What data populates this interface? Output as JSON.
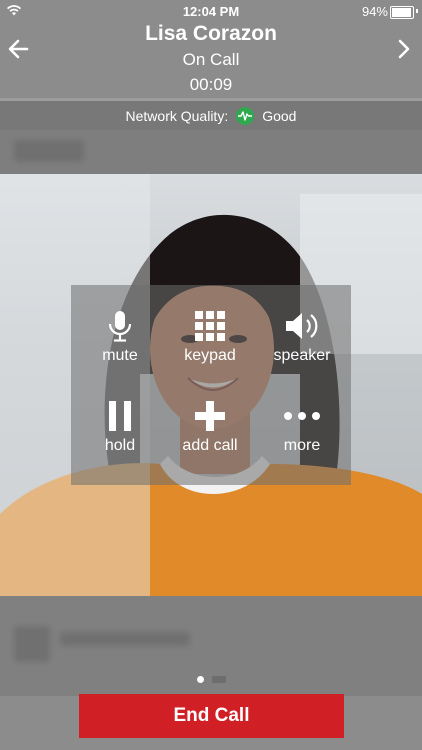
{
  "status_bar": {
    "time": "12:04 PM",
    "battery": "94%",
    "battery_level": 0.94,
    "wifi_icon": "wifi-icon"
  },
  "header": {
    "caller_name": "Lisa Corazon",
    "call_state": "On Call",
    "timer": "00:09",
    "back_icon": "arrow-left-icon",
    "forward_icon": "chevron-right-icon"
  },
  "network": {
    "label": "Network Quality:",
    "value": "Good",
    "icon": "signal-pulse-icon",
    "color": "#2fa84f"
  },
  "controls": [
    {
      "label": "mute",
      "icon": "microphone-icon"
    },
    {
      "label": "keypad",
      "icon": "keypad-icon"
    },
    {
      "label": "speaker",
      "icon": "speaker-icon"
    },
    {
      "label": "hold",
      "icon": "pause-icon"
    },
    {
      "label": "add call",
      "icon": "plus-icon"
    },
    {
      "label": "more",
      "icon": "more-dots-icon"
    }
  ],
  "pager": {
    "pages": 2,
    "active": 1
  },
  "end_call": {
    "label": "End Call",
    "color": "#d11f26"
  }
}
